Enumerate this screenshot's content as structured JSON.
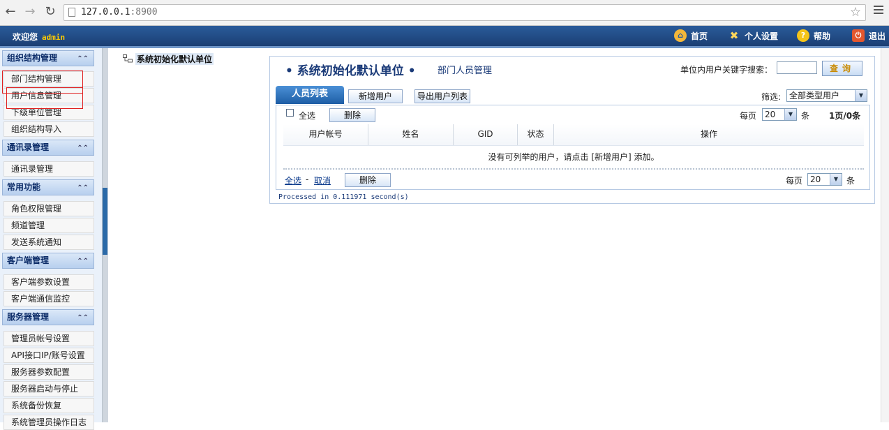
{
  "browser": {
    "url_host": "127.0.0.1",
    "url_port": ":8900"
  },
  "topbar": {
    "welcome": "欢迎您",
    "username": "admin",
    "nav": [
      {
        "label": "首页",
        "icon": "home-icon"
      },
      {
        "label": "个人设置",
        "icon": "tools-icon"
      },
      {
        "label": "帮助",
        "icon": "help-icon"
      },
      {
        "label": "退出",
        "icon": "logout-icon"
      }
    ]
  },
  "sidebar": {
    "groups": [
      {
        "title": "组织结构管理",
        "items": [
          "部门结构管理",
          "用户信息管理",
          "下级单位管理",
          "组织结构导入"
        ]
      },
      {
        "title": "通讯录管理",
        "items": [
          "通讯录管理"
        ]
      },
      {
        "title": "常用功能",
        "items": [
          "角色权限管理",
          "频道管理",
          "发送系统通知"
        ]
      },
      {
        "title": "客户端管理",
        "items": [
          "客户端参数设置",
          "客户端通信监控"
        ]
      },
      {
        "title": "服务器管理",
        "items": [
          "管理员帐号设置",
          "API接口IP/账号设置",
          "服务器参数配置",
          "服务器启动与停止",
          "系统备份恢复",
          "系统管理员操作日志"
        ]
      }
    ]
  },
  "crumb": {
    "label": "系统初始化默认单位"
  },
  "panel": {
    "title": "• 系统初始化默认单位 •",
    "subtitle": "部门人员管理",
    "search_label": "单位内用户关键字搜索：",
    "search_button": "查询",
    "tab_active": "人员列表",
    "add_user": "新增用户",
    "export_list": "导出用户列表",
    "filter_label": "筛选:",
    "filter_value": "全部类型用户",
    "select_all": "全选",
    "delete": "删除",
    "per_page_label": "每页",
    "per_page_value": "20",
    "per_page_unit": "条",
    "page_info": "1页/0条",
    "columns": [
      "用户帐号",
      "姓名",
      "GID",
      "状态",
      "操作"
    ],
    "empty_message": "没有可列举的用户，请点击 [新增用户] 添加。",
    "footer_select_all": "全选",
    "footer_sep": "-",
    "footer_cancel": "取消",
    "processed": "Processed in 0.111971 second(s)"
  }
}
